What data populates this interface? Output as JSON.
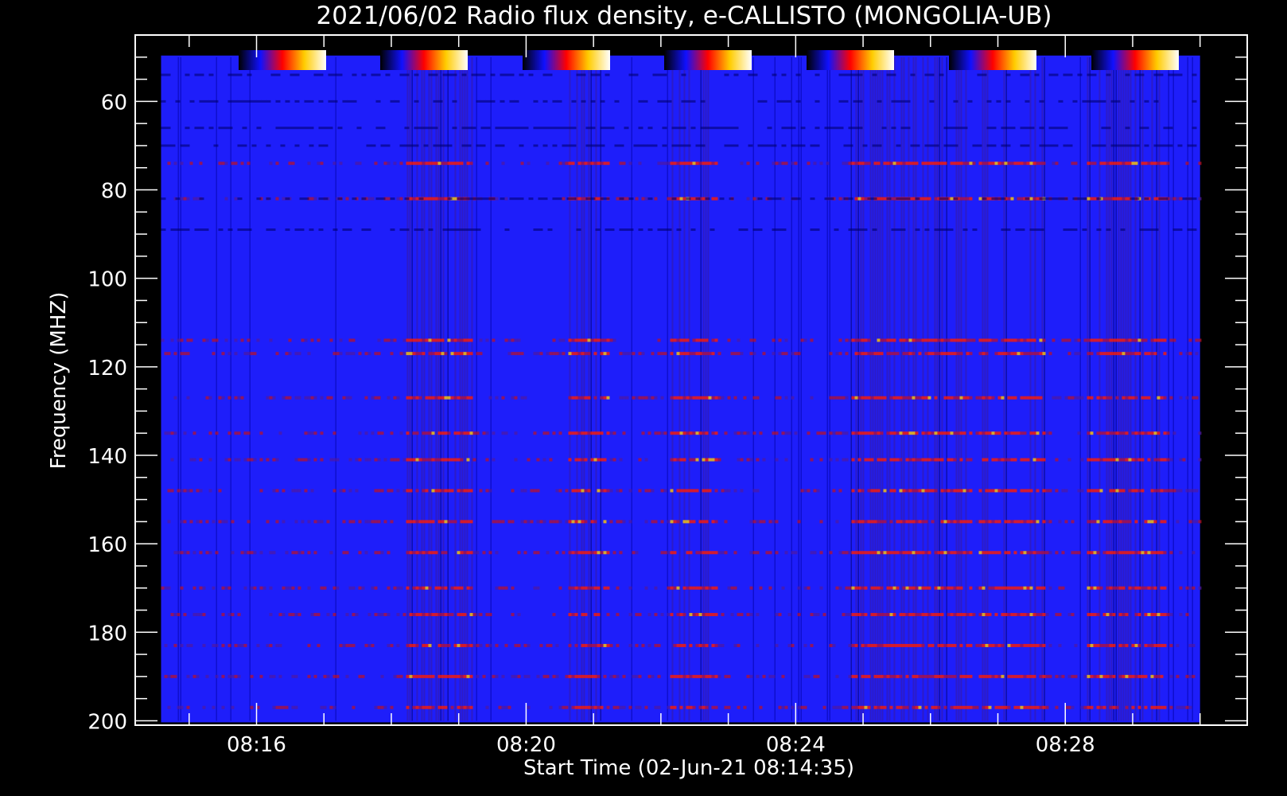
{
  "chart_data": {
    "type": "heatmap",
    "title": "2021/06/02  Radio flux density, e-CALLISTO (MONGOLIA-UB)",
    "xlabel": "Start Time (02-Jun-21 08:14:35)",
    "ylabel": "Frequency (MHZ)",
    "x_start": "08:14:35",
    "x_end": "08:30:00",
    "x_ticks": [
      {
        "label": "08:16",
        "minutes": 16
      },
      {
        "label": "08:20",
        "minutes": 20
      },
      {
        "label": "08:24",
        "minutes": 24
      },
      {
        "label": "08:28",
        "minutes": 28
      }
    ],
    "xlim_minutes": [
      14.2,
      30.7
    ],
    "ylim": [
      201,
      45
    ],
    "y_ticks": [
      60,
      80,
      100,
      120,
      140,
      160,
      180,
      200
    ],
    "y_range_data": [
      50,
      200
    ],
    "colormap": [
      "#000000",
      "#0000ff",
      "#ff0000",
      "#ffff00",
      "#ffffff"
    ],
    "background_color": "#1e1efa",
    "grid": false,
    "emission_bands_mhz": [
      74,
      82,
      114,
      117,
      127,
      135,
      141,
      148,
      155,
      162,
      170,
      176,
      183,
      190,
      197
    ],
    "active_segments_minutes": [
      {
        "start": 18.2,
        "end": 19.2
      },
      {
        "start": 20.6,
        "end": 21.2
      },
      {
        "start": 22.1,
        "end": 22.8
      },
      {
        "start": 24.8,
        "end": 26.6
      },
      {
        "start": 26.7,
        "end": 27.7
      },
      {
        "start": 28.3,
        "end": 29.5
      }
    ]
  }
}
